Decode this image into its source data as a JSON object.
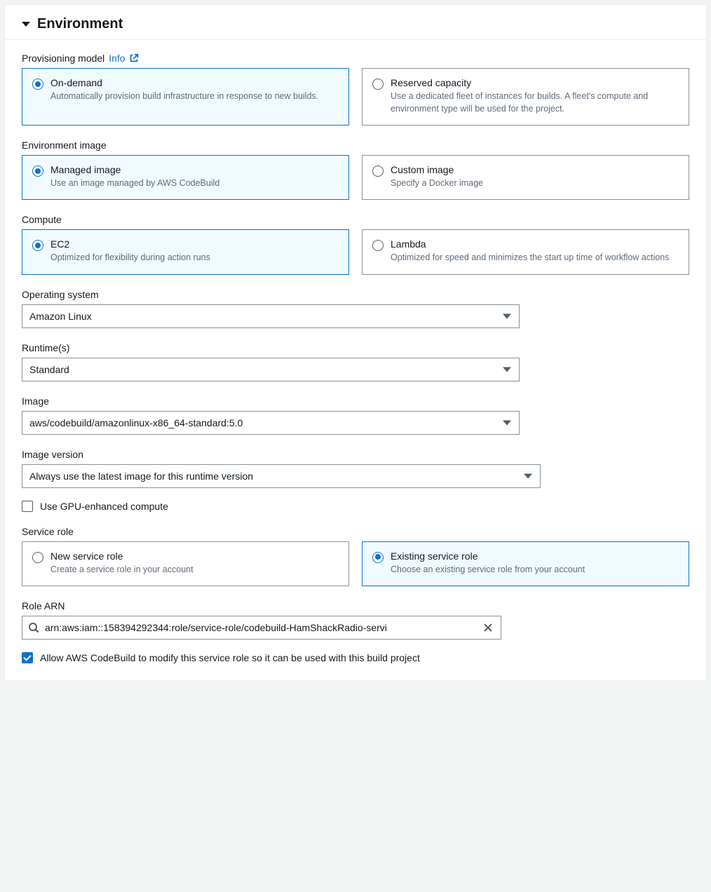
{
  "section": {
    "title": "Environment"
  },
  "provisioning": {
    "label": "Provisioning model",
    "info_label": "Info",
    "options": [
      {
        "title": "On-demand",
        "desc": "Automatically provision build infrastructure in response to new builds.",
        "selected": true
      },
      {
        "title": "Reserved capacity",
        "desc": "Use a dedicated fleet of instances for builds. A fleet's compute and environment type will be used for the project.",
        "selected": false
      }
    ]
  },
  "env_image": {
    "label": "Environment image",
    "options": [
      {
        "title": "Managed image",
        "desc": "Use an image managed by AWS CodeBuild",
        "selected": true
      },
      {
        "title": "Custom image",
        "desc": "Specify a Docker image",
        "selected": false
      }
    ]
  },
  "compute": {
    "label": "Compute",
    "options": [
      {
        "title": "EC2",
        "desc": "Optimized for flexibility during action runs",
        "selected": true
      },
      {
        "title": "Lambda",
        "desc": "Optimized for speed and minimizes the start up time of workflow actions",
        "selected": false
      }
    ]
  },
  "os": {
    "label": "Operating system",
    "value": "Amazon Linux"
  },
  "runtime": {
    "label": "Runtime(s)",
    "value": "Standard"
  },
  "image": {
    "label": "Image",
    "value": "aws/codebuild/amazonlinux-x86_64-standard:5.0"
  },
  "image_version": {
    "label": "Image version",
    "value": "Always use the latest image for this runtime version"
  },
  "gpu": {
    "checked": false,
    "label": "Use GPU-enhanced compute"
  },
  "service_role": {
    "label": "Service role",
    "options": [
      {
        "title": "New service role",
        "desc": "Create a service role in your account",
        "selected": false
      },
      {
        "title": "Existing service role",
        "desc": "Choose an existing service role from your account",
        "selected": true
      }
    ]
  },
  "role_arn": {
    "label": "Role ARN",
    "value": "arn:aws:iam::158394292344:role/service-role/codebuild-HamShackRadio-servi"
  },
  "allow_modify": {
    "checked": true,
    "label": "Allow AWS CodeBuild to modify this service role so it can be used with this build project"
  }
}
